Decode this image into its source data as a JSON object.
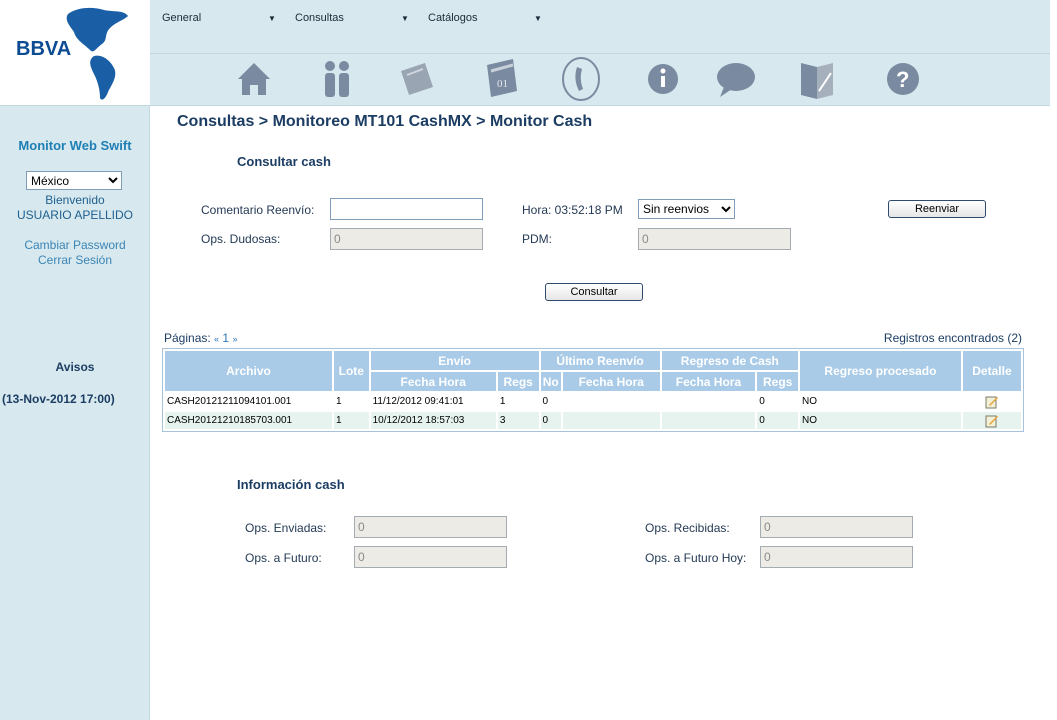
{
  "brand": {
    "logo_text": "BBVA"
  },
  "sidebar": {
    "app_title": "Monitor Web Swift",
    "country": "México",
    "welcome": "Bienvenido",
    "user": "USUARIO APELLIDO",
    "change_password": "Cambiar Password",
    "logout": "Cerrar Sesión",
    "notices_title": "Avisos",
    "notice_date": "(13-Nov-2012 17:00)"
  },
  "menu": [
    {
      "label": "General"
    },
    {
      "label": "Consultas"
    },
    {
      "label": "Catálogos"
    }
  ],
  "toolbar_icons": [
    "home-icon",
    "users-icon",
    "document-icon",
    "calendar-icon",
    "phone-icon",
    "info-icon",
    "chat-bubble-icon",
    "edit-document-icon",
    "help-icon"
  ],
  "breadcrumb": "Consultas > Monitoreo MT101 CashMX > Monitor Cash",
  "consultar": {
    "title": "Consultar cash",
    "comment_label": "Comentario Reenvío:",
    "comment_value": "",
    "time_label": "Hora: 03:52:18 PM",
    "resend_option": "Sin reenvios",
    "resend_button": "Reenviar",
    "doubtful_label": "Ops. Dudosas:",
    "doubtful_value": "0",
    "pdm_label": "PDM:",
    "pdm_value": "0",
    "query_button": "Consultar"
  },
  "pager": {
    "label": "Páginas:",
    "prev": "«",
    "page": "1",
    "next": "»",
    "records": "Registros encontrados (2)"
  },
  "table": {
    "headers": {
      "archivo": "Archivo",
      "lote": "Lote",
      "envio": "Envío",
      "ultimo": "Último Reenvío",
      "regreso": "Regreso de Cash",
      "procesado": "Regreso procesado",
      "detalle": "Detalle",
      "fecha_hora": "Fecha Hora",
      "regs": "Regs",
      "no": "No"
    },
    "rows": [
      {
        "archivo": "CASH20121211094101.001",
        "lote": "1",
        "envio_fecha": "11/12/2012 09:41:01",
        "envio_regs": "1",
        "reenvio_no": "0",
        "reenvio_fecha": "",
        "regreso_fecha": "",
        "regreso_regs": "0",
        "procesado": "NO"
      },
      {
        "archivo": "CASH20121210185703.001",
        "lote": "1",
        "envio_fecha": "10/12/2012 18:57:03",
        "envio_regs": "3",
        "reenvio_no": "0",
        "reenvio_fecha": "",
        "regreso_fecha": "",
        "regreso_regs": "0",
        "procesado": "NO"
      }
    ]
  },
  "info": {
    "title": "Información cash",
    "sent_label": "Ops. Enviadas:",
    "sent_value": "0",
    "received_label": "Ops. Recibidas:",
    "received_value": "0",
    "future_label": "Ops. a Futuro:",
    "future_value": "0",
    "future_today_label": "Ops. a Futuro Hoy:",
    "future_today_value": "0"
  },
  "colors": {
    "sidebar_bg": "#d7e9ee",
    "table_header": "#a9cbe8",
    "title_blue": "#1c3d63",
    "link_blue": "#2e77ba"
  }
}
